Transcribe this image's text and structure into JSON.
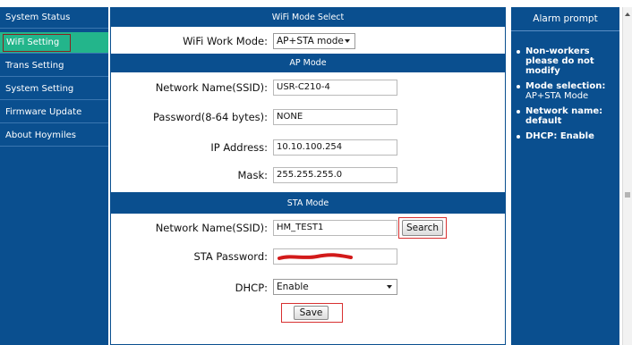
{
  "sidebar": {
    "items": [
      {
        "label": "System Status"
      },
      {
        "label": "WiFi Setting"
      },
      {
        "label": "Trans Setting"
      },
      {
        "label": "System Setting"
      },
      {
        "label": "Firmware Update"
      },
      {
        "label": "About Hoymiles"
      }
    ]
  },
  "wifi_mode": {
    "header": "WiFi Mode Select",
    "label": "WiFi Work Mode:",
    "value": "AP+STA mode"
  },
  "ap_mode": {
    "header": "AP Mode",
    "ssid_label": "Network Name(SSID):",
    "ssid_value": "USR-C210-4",
    "password_label": "Password(8-64 bytes):",
    "password_value": "NONE",
    "ip_label": "IP Address:",
    "ip_value": "10.10.100.254",
    "mask_label": "Mask:",
    "mask_value": "255.255.255.0"
  },
  "sta_mode": {
    "header": "STA Mode",
    "ssid_label": "Network Name(SSID):",
    "ssid_value": "HM_TEST1",
    "search_label": "Search",
    "password_label": "STA Password:",
    "dhcp_label": "DHCP:",
    "dhcp_value": "Enable"
  },
  "save_label": "Save",
  "alarm": {
    "title": "Alarm prompt",
    "items": [
      {
        "bold": "Non-workers please do not modify",
        "text": ""
      },
      {
        "bold": "Mode selection:",
        "text": "AP+STA Mode"
      },
      {
        "bold": "Network name:",
        "text": "default"
      },
      {
        "bold": "DHCP: Enable",
        "text": ""
      }
    ]
  },
  "colors": {
    "panel_blue": "#0a4f8f",
    "active_green": "#23b58b",
    "highlight_red": "#d83030"
  }
}
